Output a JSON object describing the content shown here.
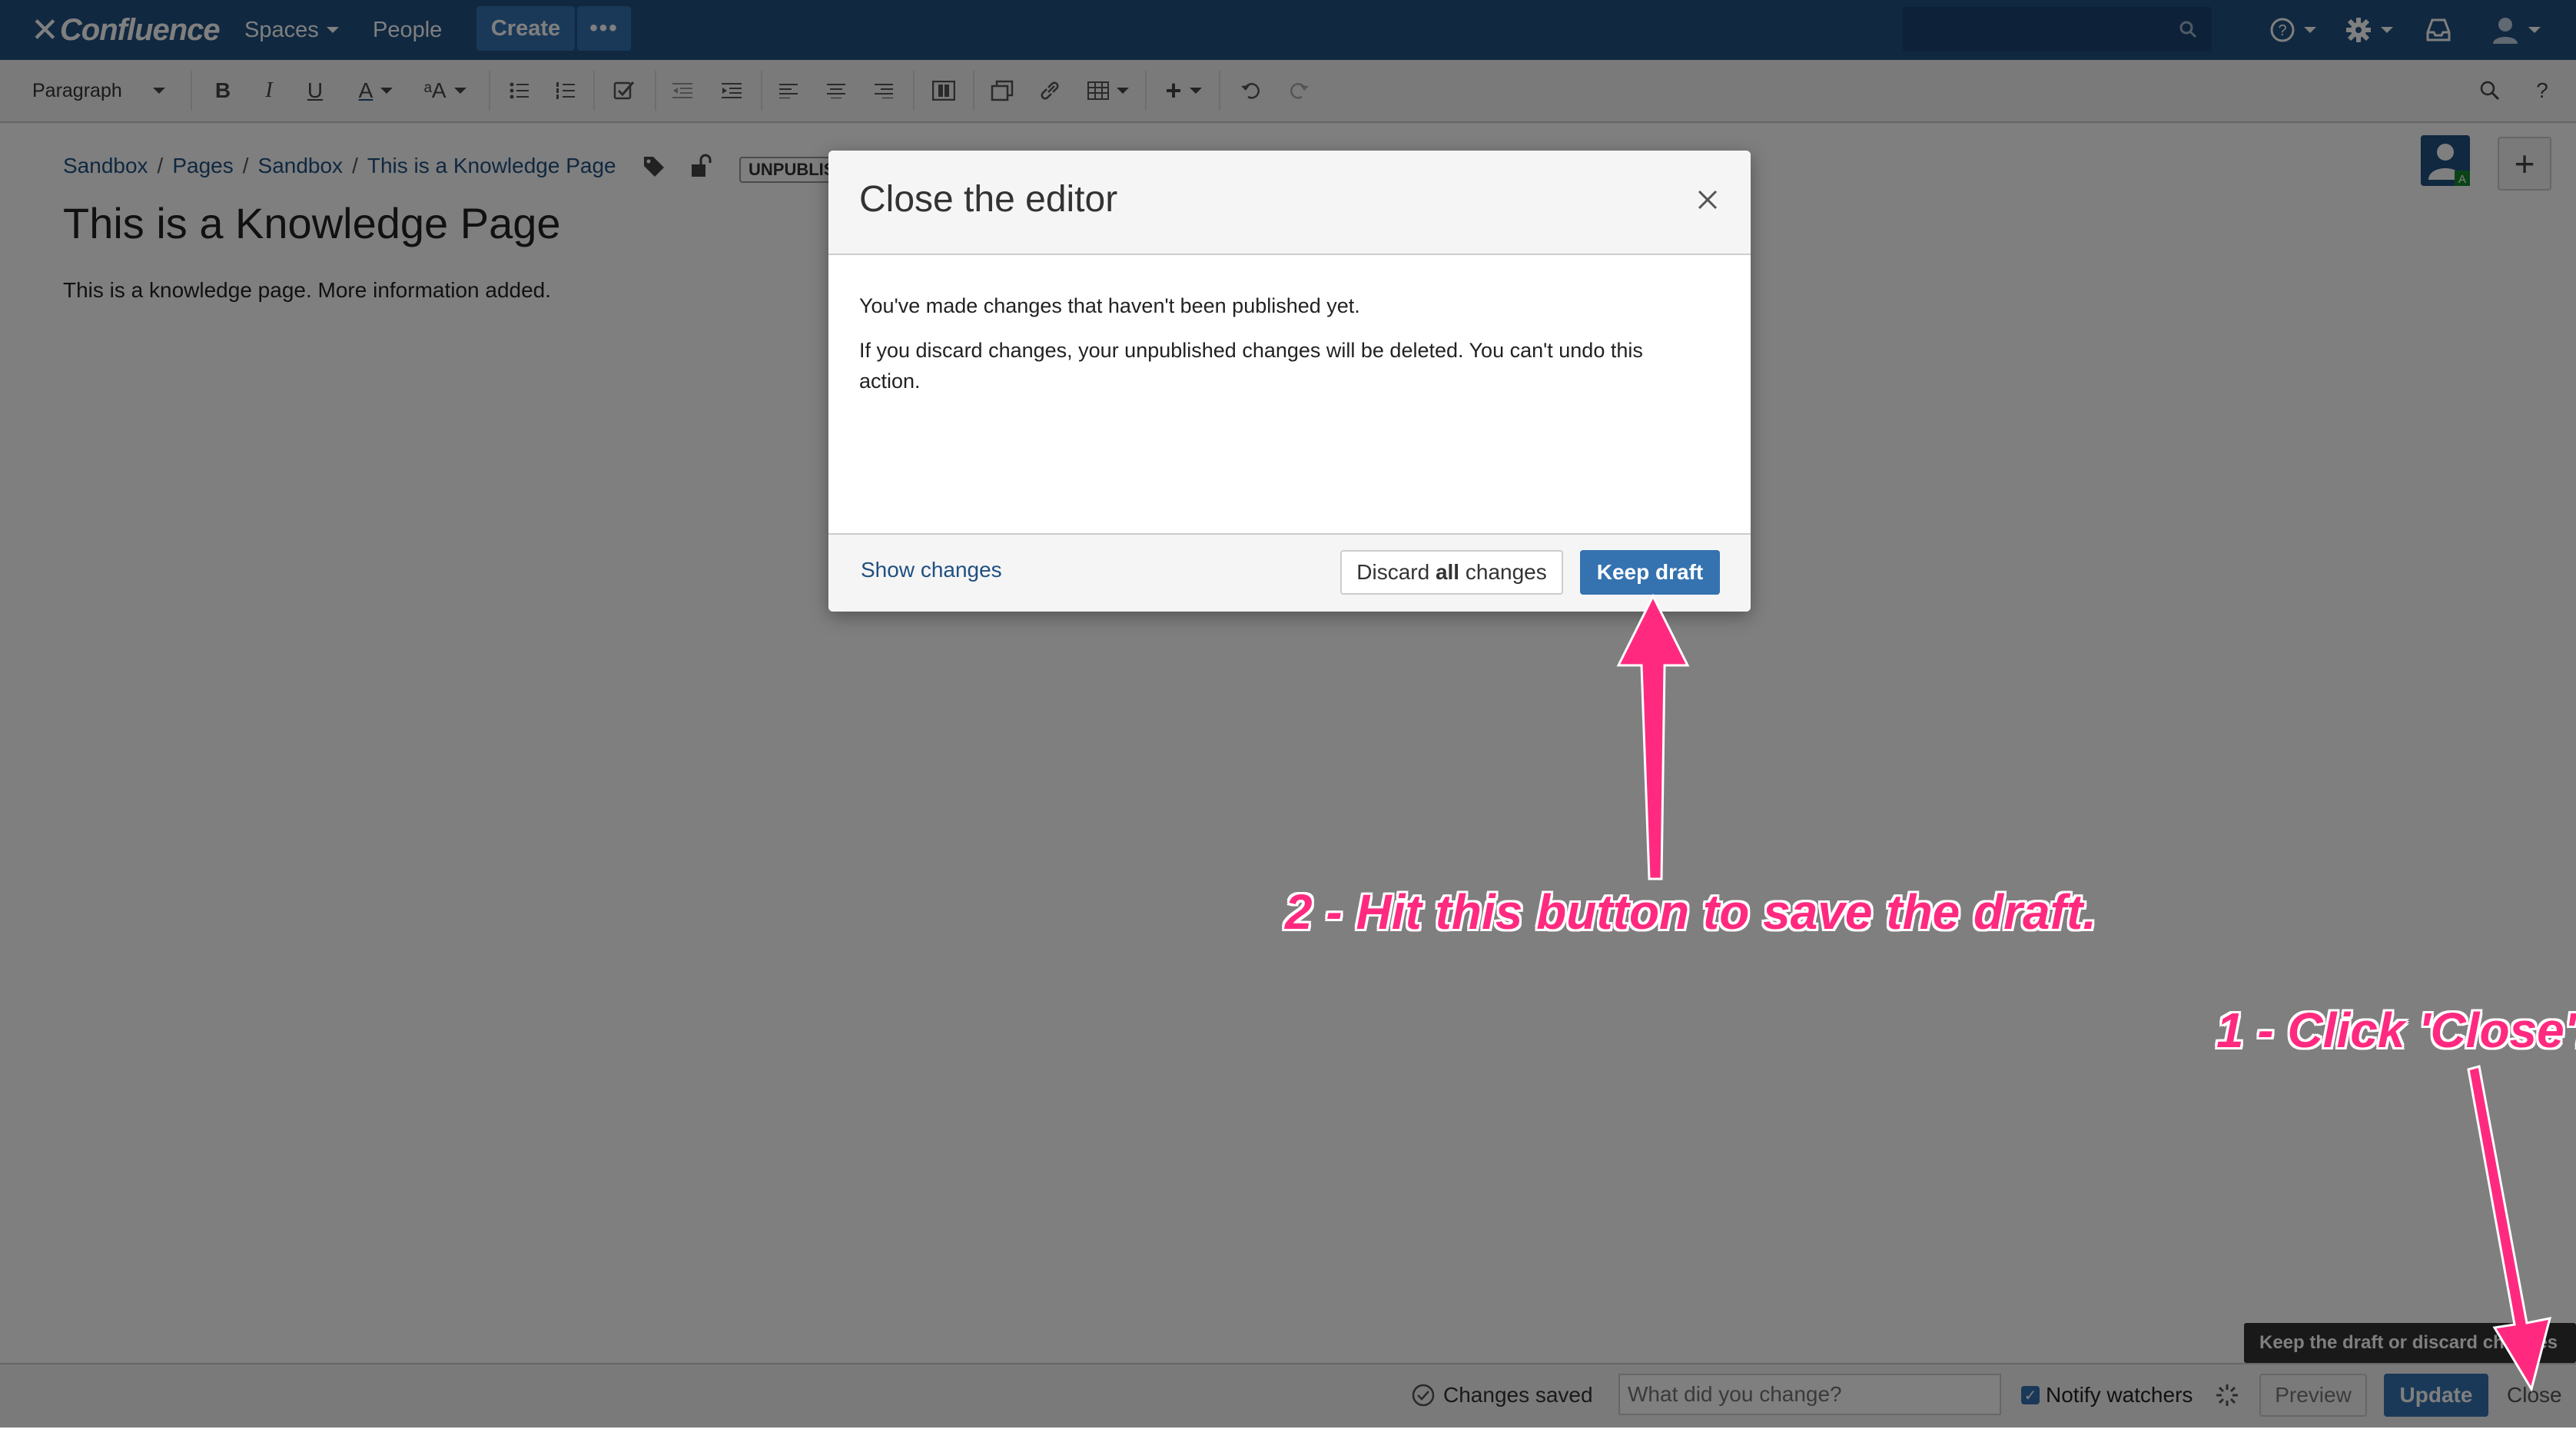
{
  "topnav": {
    "logo": "Confluence",
    "spaces": "Spaces",
    "people": "People",
    "create": "Create",
    "more": "•••"
  },
  "toolbar": {
    "paragraph": "Paragraph",
    "bold": "B",
    "italic": "I",
    "underline": "U",
    "text_color": "A",
    "format": "ᵃA",
    "help": "?"
  },
  "page": {
    "breadcrumbs": [
      "Sandbox",
      "Pages",
      "Sandbox",
      "This is a Knowledge Page"
    ],
    "breadcrumb_sep": "/",
    "status": "UNPUBLIS",
    "title": "This is a Knowledge Page",
    "body": "This is a knowledge page. More information added."
  },
  "dialog": {
    "title": "Close the editor",
    "p1": "You've made changes that haven't been published yet.",
    "p2": "If you discard changes, your unpublished changes will be deleted. You can't undo this action.",
    "show_changes": "Show changes",
    "discard_pre": "Discard ",
    "discard_bold": "all",
    "discard_post": " changes",
    "keep": "Keep draft"
  },
  "bottom": {
    "saved": "Changes saved",
    "comment_placeholder": "What did you change?",
    "notify": "Notify watchers",
    "preview": "Preview",
    "update": "Update",
    "close": "Close",
    "tooltip": "Keep the draft or discard changes"
  },
  "annotations": {
    "step1": "1 - Click 'Close'.",
    "step2": "2 - Hit this button to save the draft."
  },
  "colors": {
    "nav": "#205081",
    "primary": "#3572b0",
    "annotation": "#ff2a7f"
  }
}
